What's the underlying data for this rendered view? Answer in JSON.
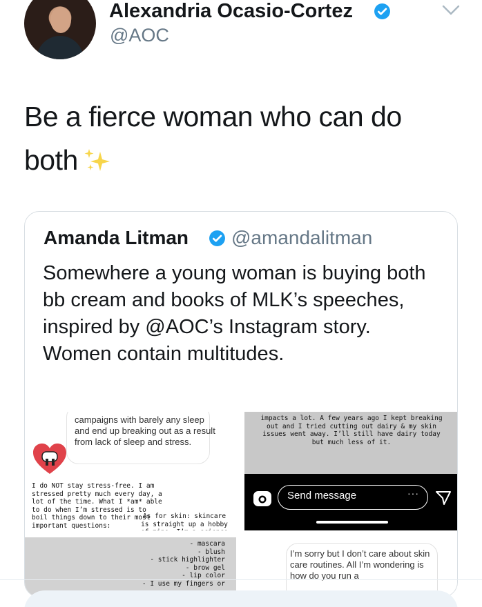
{
  "author": {
    "name": "Alexandria Ocasio-Cortez",
    "handle": "@AOC",
    "verified": true
  },
  "tweet": {
    "text": "Be a fierce woman who can do both",
    "emoji_icon": "sparkles-icon"
  },
  "quoted_tweet": {
    "name": "Amanda Litman",
    "handle": "@amandalitman",
    "verified": true,
    "text": "Somewhere a young woman is buying both bb cream and books of MLK’s speeches, inspired by @AOC’s Instagram story. Women contain multitudes.",
    "images": {
      "image1": {
        "bubble_text": "campaigns with barely any sleep and end up breaking out as a result from lack of sleep and stress.",
        "typed_note": "I do NOT stay stress-free. I am stressed pretty much every day, a lot of the time. What I *am* able to do when I’m stressed is to boil things down to their most important questions:",
        "typed_note_2": "As for skin: skincare is straight up a hobby of mine. I’m a science nerd"
      },
      "image2": {
        "typed_note": "impacts a lot. A few years ago I kept breaking out and I tried cutting out dairy & my skin issues went away. I’ll still have dairy today but much less of it.",
        "send_placeholder": "Send message",
        "more_label": "···"
      },
      "image3": {
        "typed_list": "- mascara\n- blush\n- stick highlighter\n- brow gel\n- lip color\n- I use my fingers or"
      },
      "image4": {
        "bubble_text": "I’m sorry but I don’t care about skin care routines. All I’m wondering is how do you run a"
      }
    }
  },
  "colors": {
    "verified_blue": "#1da1f2",
    "secondary_text": "#657786",
    "border": "#d8dee3",
    "reply_bar": "#edf3f8"
  }
}
